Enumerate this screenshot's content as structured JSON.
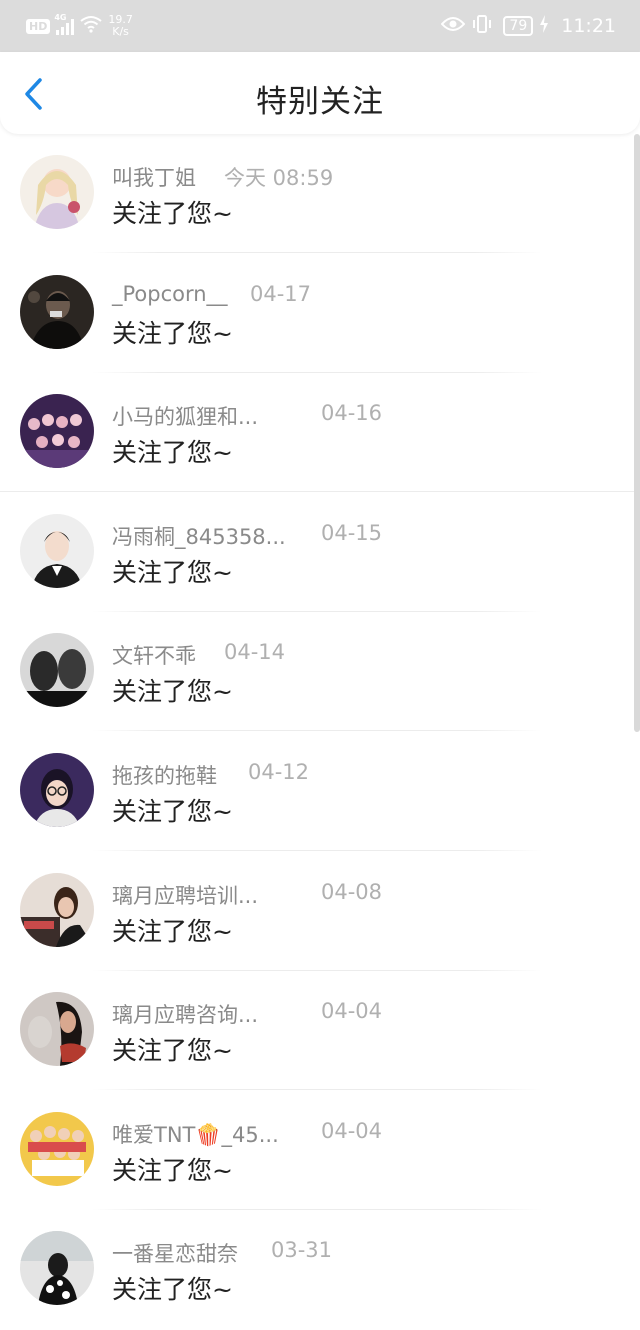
{
  "status_bar": {
    "hd": "HD",
    "network": "4G",
    "speed_value": "19.7",
    "speed_unit": "K/s",
    "battery": "79",
    "time": "11:21"
  },
  "header": {
    "title": "特别关注"
  },
  "items": [
    {
      "name": "叫我丁姐",
      "date": "今天 08:59",
      "message": "关注了您~"
    },
    {
      "name": "_Popcorn__",
      "date": "04-17",
      "message": "关注了您~"
    },
    {
      "name": "小马的狐狸和...",
      "date": "04-16",
      "message": "关注了您~"
    },
    {
      "name": "冯雨桐_845358...",
      "date": "04-15",
      "message": "关注了您~"
    },
    {
      "name": "文轩不乖",
      "date": "04-14",
      "message": "关注了您~"
    },
    {
      "name": "拖孩的拖鞋",
      "date": "04-12",
      "message": "关注了您~"
    },
    {
      "name": "璃月应聘培训...",
      "date": "04-08",
      "message": "关注了您~"
    },
    {
      "name": "璃月应聘咨询...",
      "date": "04-04",
      "message": "关注了您~"
    },
    {
      "name": "唯爱TNT🍿_45...",
      "date": "04-04",
      "message": "关注了您~"
    },
    {
      "name": "一番星恋甜奈",
      "date": "03-31",
      "message": "关注了您~"
    }
  ],
  "colors": {
    "accent": "#1e88e5",
    "status_bar_bg": "#dcdcdc",
    "name_text": "#8a8a8a",
    "date_text": "#b0b0b0"
  }
}
